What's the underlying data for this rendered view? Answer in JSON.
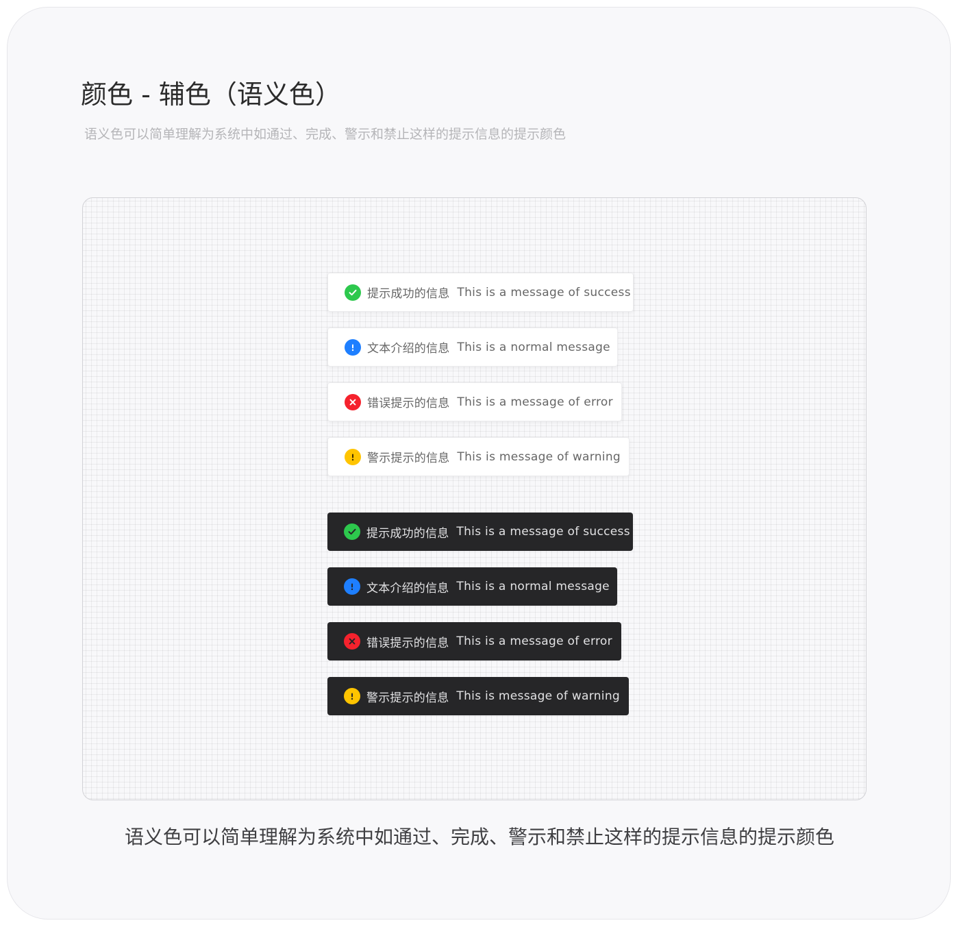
{
  "header": {
    "title": "颜色 - 辅色（语义色）",
    "subtitle": "语义色可以简单理解为系统中如通过、完成、警示和禁止这样的提示信息的提示颜色"
  },
  "colors": {
    "success": "#2DC84D",
    "info": "#1E7FFF",
    "error": "#F5222D",
    "warning": "#FFC400",
    "dark_background": "#262628",
    "light_background": "#FFFFFF"
  },
  "messages_light": [
    {
      "type": "success",
      "icon": "check-circle-icon",
      "cn": "提示成功的信息",
      "en": "This is a message of success"
    },
    {
      "type": "info",
      "icon": "info-circle-icon",
      "cn": "文本介绍的信息",
      "en": "This is a normal message"
    },
    {
      "type": "error",
      "icon": "close-circle-icon",
      "cn": "错误提示的信息",
      "en": "This is a message of error"
    },
    {
      "type": "warning",
      "icon": "warning-circle-icon",
      "cn": "警示提示的信息",
      "en": "This is message of warning"
    }
  ],
  "messages_dark": [
    {
      "type": "success",
      "icon": "check-circle-icon",
      "cn": "提示成功的信息",
      "en": "This is a message of success"
    },
    {
      "type": "info",
      "icon": "info-circle-icon",
      "cn": "文本介绍的信息",
      "en": "This is a normal message"
    },
    {
      "type": "error",
      "icon": "close-circle-icon",
      "cn": "错误提示的信息",
      "en": "This is a message of error"
    },
    {
      "type": "warning",
      "icon": "warning-circle-icon",
      "cn": "警示提示的信息",
      "en": "This is message of warning"
    }
  ],
  "footer": {
    "caption": "语义色可以简单理解为系统中如通过、完成、警示和禁止这样的提示信息的提示颜色"
  }
}
